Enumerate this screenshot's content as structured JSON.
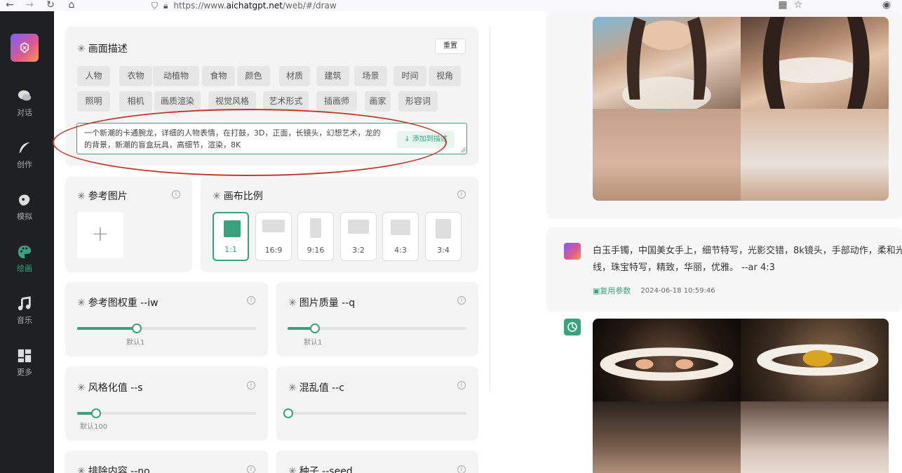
{
  "browser": {
    "url_prefix": "https://www.",
    "url_domain": "aichatgpt.net",
    "url_path": "/web/#/draw"
  },
  "sidebar": {
    "items": [
      {
        "label": "对话",
        "icon": "chat-icon"
      },
      {
        "label": "创作",
        "icon": "feather-icon"
      },
      {
        "label": "模拟",
        "icon": "mask-icon"
      },
      {
        "label": "绘画",
        "icon": "palette-icon",
        "active": true
      },
      {
        "label": "音乐",
        "icon": "music-icon"
      },
      {
        "label": "更多",
        "icon": "grid-icon"
      }
    ]
  },
  "description": {
    "title": "画面描述",
    "reset_label": "重置",
    "tags_row1": [
      "人物",
      "衣物",
      "动植物",
      "食物",
      "颜色",
      "材质",
      "建筑",
      "场景",
      "时间",
      "视角"
    ],
    "tags_row2": [
      "照明",
      "相机",
      "画质渲染",
      "视觉风格",
      "艺术形式",
      "插画师",
      "画家",
      "形容词"
    ],
    "text_line1": "一个新潮的卡通腕龙，详细的人物表情，在打鼓，3D，正面，长镜头，幻想艺术，龙的",
    "text_line2": "的背景，新潮的盲盒玩具，高细节，渲染，8K",
    "add_label": "↓ 添加到描述"
  },
  "reference": {
    "title": "参考图片",
    "upload_symbol": "+"
  },
  "ratio": {
    "title": "画布比例",
    "options": [
      "1:1",
      "16:9",
      "9:16",
      "3:2",
      "4:3",
      "3:4"
    ],
    "selected": "1:1"
  },
  "params": {
    "iw": {
      "title": "参考图权重 --iw",
      "hint": "默认1",
      "fill": 0.33
    },
    "q": {
      "title": "图片质量 --q",
      "hint": "默认1",
      "fill": 0.15
    },
    "s": {
      "title": "风格化值 --s",
      "hint": "默认100",
      "fill": 0.1
    },
    "c": {
      "title": "混乱值 --c",
      "fill": 0.0
    },
    "no": {
      "title": "排除内容 --no"
    },
    "seed": {
      "title": "种子 --seed"
    }
  },
  "chat": {
    "message_line1": "白玉手镯，中国美女手上，细节特写，光影交错，8k镜头，手部动作，柔和光",
    "message_line2": "线，珠宝特写，精致，华丽，优雅。 --ar 4:3",
    "reuse_label": "复用参数",
    "timestamp": "2024-06-18 10:59:46"
  },
  "colors": {
    "accent": "#3aa17e",
    "sidebar_bg": "#1f2023",
    "annotation": "#c0392b"
  }
}
